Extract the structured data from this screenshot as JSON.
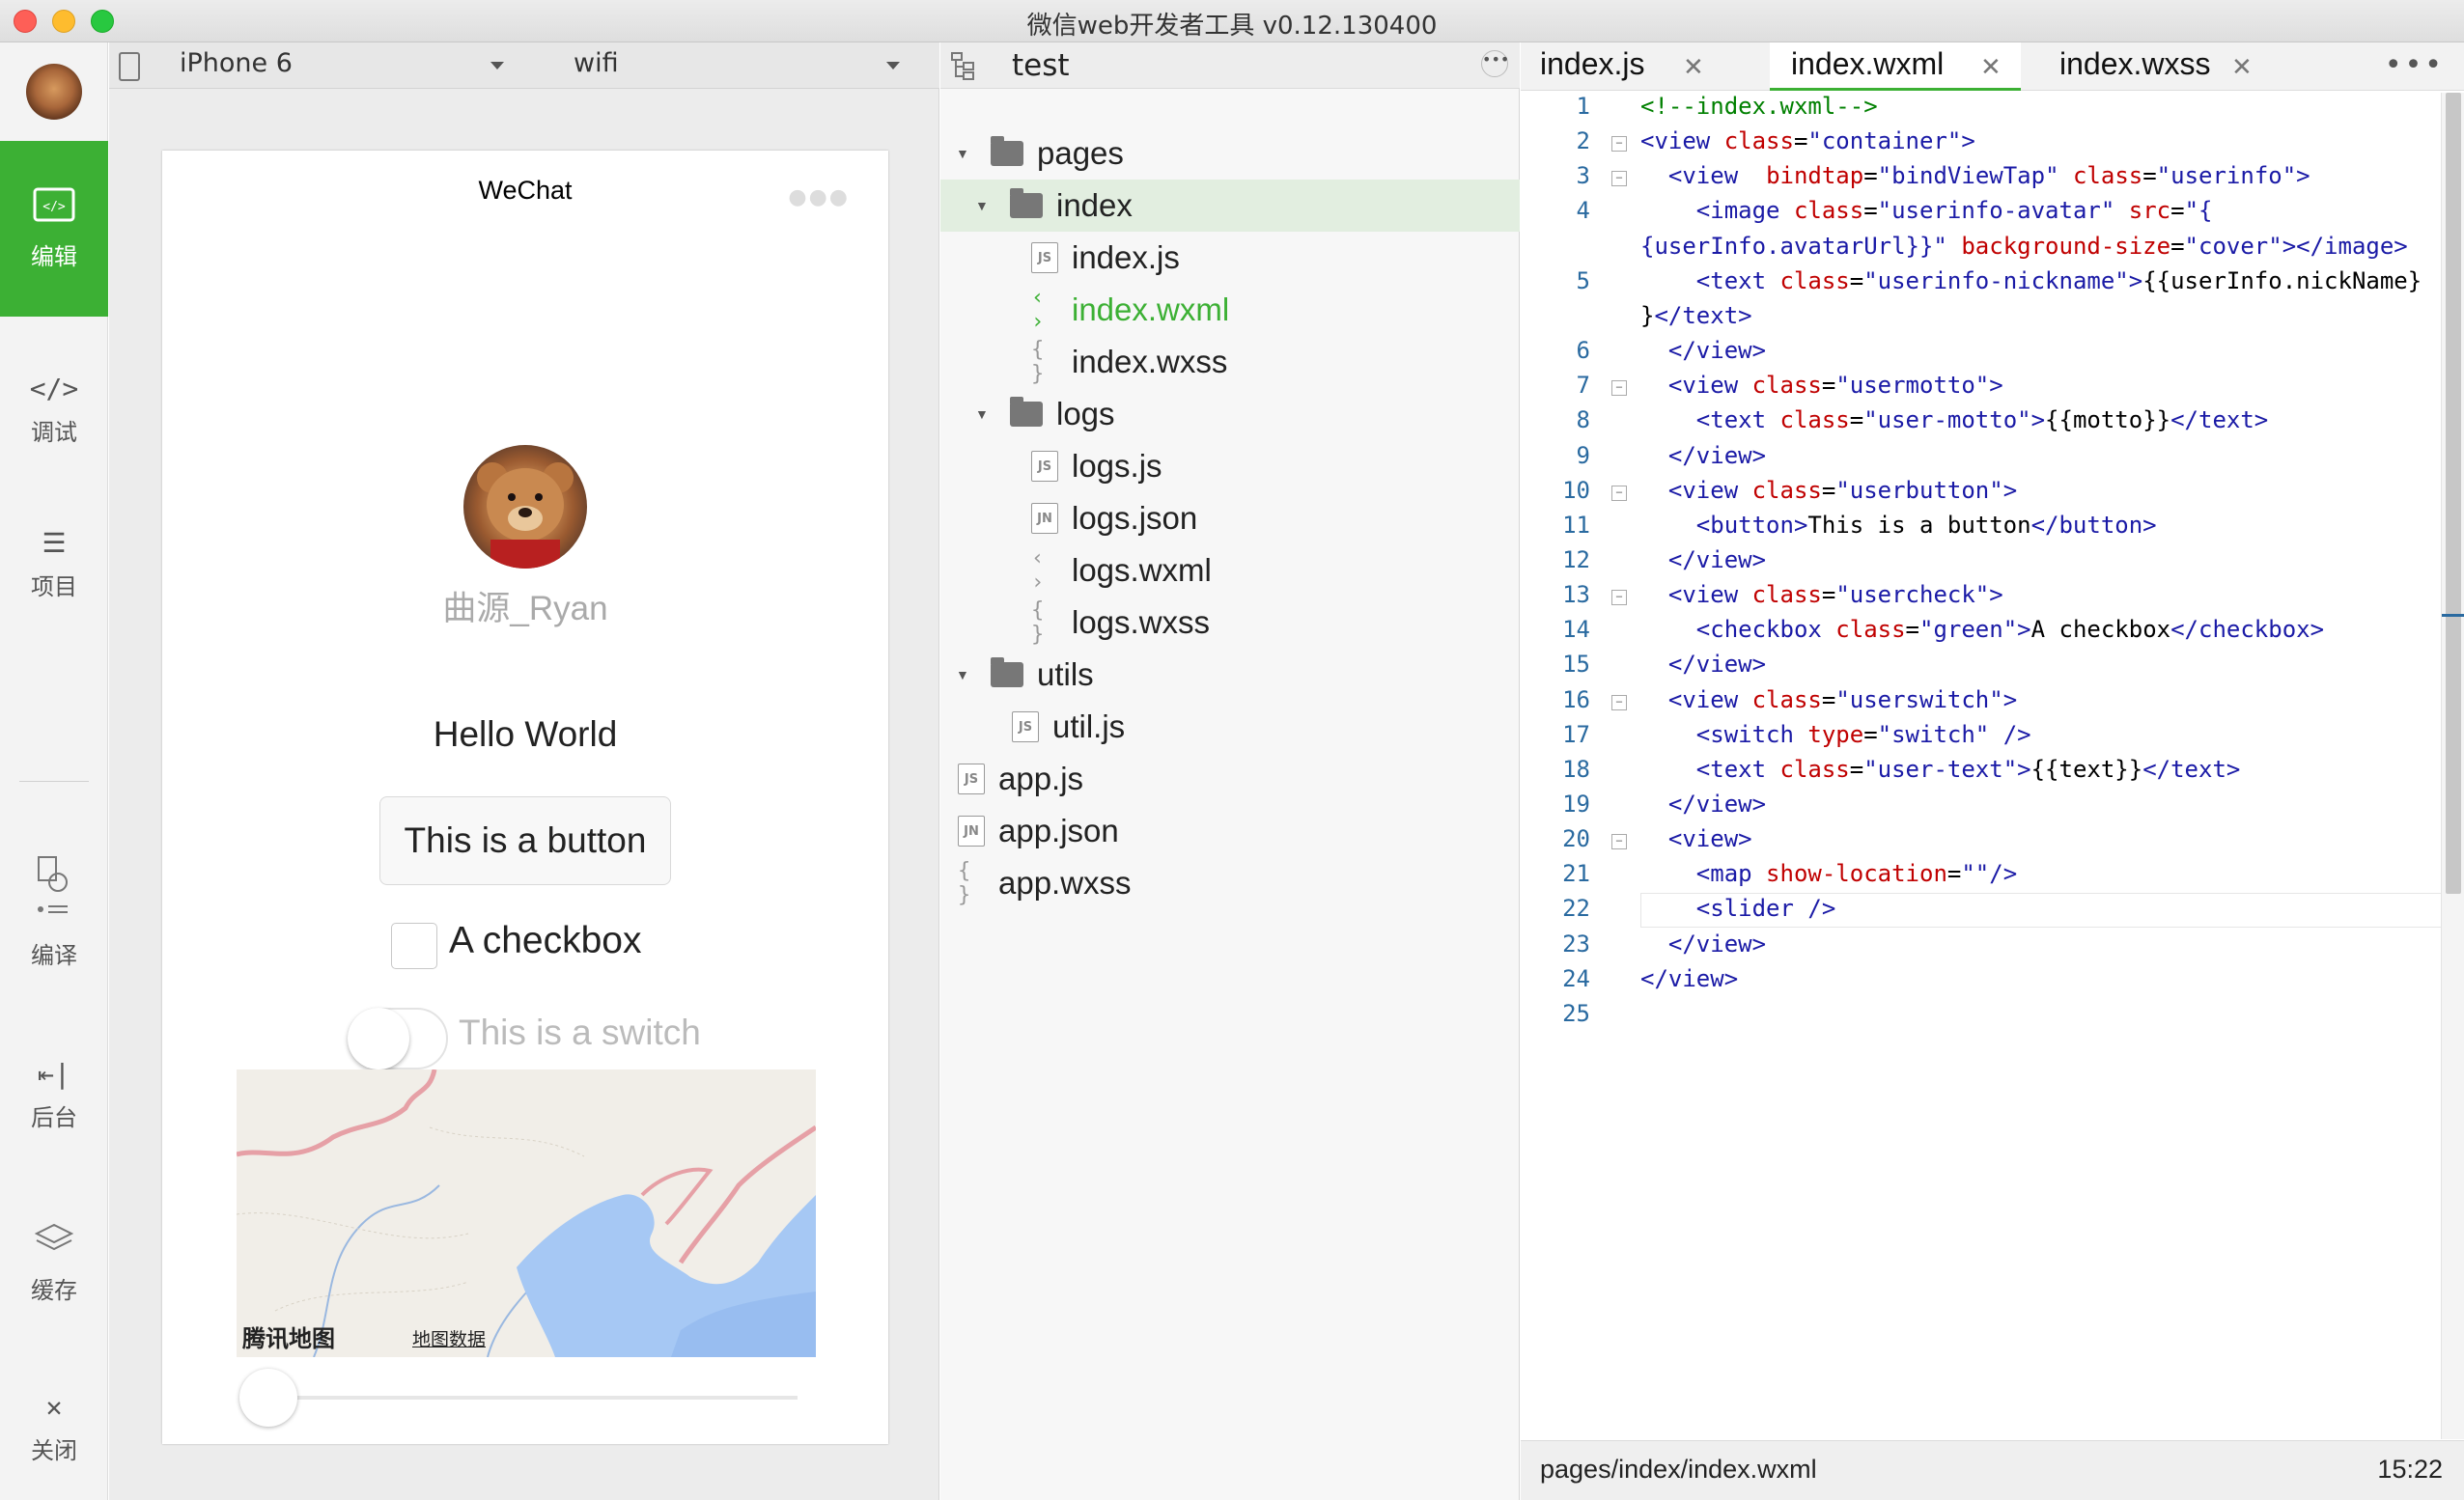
{
  "window": {
    "title": "微信web开发者工具 v0.12.130400"
  },
  "sidebar": {
    "items": [
      {
        "icon": "code-icon",
        "glyph": "<‧>",
        "label": "编辑"
      },
      {
        "icon": "debug-icon",
        "glyph": "</>",
        "label": "调试"
      },
      {
        "icon": "menu-icon",
        "glyph": "☰",
        "label": "项目"
      },
      {
        "icon": "compile-icon",
        "glyph": "⟲",
        "label": "编译"
      },
      {
        "icon": "backend-icon",
        "glyph": "⇤|",
        "label": "后台"
      },
      {
        "icon": "layers-icon",
        "glyph": "≋",
        "label": "缓存"
      },
      {
        "icon": "close-icon",
        "glyph": "✕",
        "label": "关闭"
      }
    ]
  },
  "simulator": {
    "device": "iPhone 6",
    "network": "wifi",
    "page_title": "WeChat",
    "nickname": "曲源_Ryan",
    "motto": "Hello World",
    "button_label": "This is a button",
    "checkbox_label": "A checkbox",
    "switch_label": "This is a switch",
    "map_logo": "腾讯地图",
    "map_data": "地图数据",
    "slider_value": 0
  },
  "tree": {
    "project": "test",
    "rows": [
      {
        "type": "folder",
        "name": "pages",
        "depth": 0,
        "open": true
      },
      {
        "type": "folder",
        "name": "index",
        "depth": 1,
        "open": true,
        "selected": true
      },
      {
        "type": "js",
        "name": "index.js",
        "depth": 2
      },
      {
        "type": "wxml",
        "name": "index.wxml",
        "depth": 2,
        "active": true
      },
      {
        "type": "wxss",
        "name": "index.wxss",
        "depth": 2
      },
      {
        "type": "folder",
        "name": "logs",
        "depth": 1,
        "open": true
      },
      {
        "type": "js",
        "name": "logs.js",
        "depth": 2
      },
      {
        "type": "json",
        "name": "logs.json",
        "depth": 2
      },
      {
        "type": "wxml",
        "name": "logs.wxml",
        "depth": 2
      },
      {
        "type": "wxss",
        "name": "logs.wxss",
        "depth": 2
      },
      {
        "type": "folder",
        "name": "utils",
        "depth": 0,
        "open": true
      },
      {
        "type": "js",
        "name": "util.js",
        "depth": 1
      },
      {
        "type": "js",
        "name": "app.js",
        "depth": -1
      },
      {
        "type": "json",
        "name": "app.json",
        "depth": -1
      },
      {
        "type": "wxss",
        "name": "app.wxss",
        "depth": -1
      }
    ]
  },
  "editor": {
    "tabs": [
      {
        "label": "index.js",
        "active": false
      },
      {
        "label": "index.wxml",
        "active": true
      },
      {
        "label": "index.wxss",
        "active": false
      }
    ],
    "lines": [
      {
        "n": "1",
        "fold": false,
        "html": "<span class=\"cm\">&lt;!--index.wxml--&gt;</span>"
      },
      {
        "n": "2",
        "fold": true,
        "html": "<span class=\"tg\">&lt;view</span> <span class=\"at\">class</span>=<span class=\"st\">\"container\"</span><span class=\"tg\">&gt;</span>"
      },
      {
        "n": "3",
        "fold": true,
        "html": "  <span class=\"tg\">&lt;view</span>  <span class=\"at\">bindtap</span>=<span class=\"st\">\"bindViewTap\"</span> <span class=\"at\">class</span>=<span class=\"st\">\"userinfo\"</span><span class=\"tg\">&gt;</span>"
      },
      {
        "n": "4",
        "fold": false,
        "html": "    <span class=\"tg\">&lt;image</span> <span class=\"at\">class</span>=<span class=\"st\">\"userinfo-avatar\"</span> <span class=\"at\">src</span>=<span class=\"st\">\"{</span>"
      },
      {
        "n": "",
        "fold": false,
        "html": "<span class=\"st\">{userInfo.avatarUrl}}\"</span> <span class=\"at\">background-size</span>=<span class=\"st\">\"cover\"</span><span class=\"tg\">&gt;&lt;/image&gt;</span>"
      },
      {
        "n": "5",
        "fold": false,
        "html": "    <span class=\"tg\">&lt;text</span> <span class=\"at\">class</span>=<span class=\"st\">\"userinfo-nickname\"</span><span class=\"tg\">&gt;</span>{{userInfo.nickName}"
      },
      {
        "n": "",
        "fold": false,
        "html": "}<span class=\"tg\">&lt;/text&gt;</span>"
      },
      {
        "n": "6",
        "fold": false,
        "html": "  <span class=\"tg\">&lt;/view&gt;</span>"
      },
      {
        "n": "7",
        "fold": true,
        "html": "  <span class=\"tg\">&lt;view</span> <span class=\"at\">class</span>=<span class=\"st\">\"usermotto\"</span><span class=\"tg\">&gt;</span>"
      },
      {
        "n": "8",
        "fold": false,
        "html": "    <span class=\"tg\">&lt;text</span> <span class=\"at\">class</span>=<span class=\"st\">\"user-motto\"</span><span class=\"tg\">&gt;</span>{{motto}}<span class=\"tg\">&lt;/text&gt;</span>"
      },
      {
        "n": "9",
        "fold": false,
        "html": "  <span class=\"tg\">&lt;/view&gt;</span>"
      },
      {
        "n": "10",
        "fold": true,
        "html": "  <span class=\"tg\">&lt;view</span> <span class=\"at\">class</span>=<span class=\"st\">\"userbutton\"</span><span class=\"tg\">&gt;</span>"
      },
      {
        "n": "11",
        "fold": false,
        "html": "    <span class=\"tg\">&lt;button&gt;</span>This is a button<span class=\"tg\">&lt;/button&gt;</span>"
      },
      {
        "n": "12",
        "fold": false,
        "html": "  <span class=\"tg\">&lt;/view&gt;</span>"
      },
      {
        "n": "13",
        "fold": true,
        "html": "  <span class=\"tg\">&lt;view</span> <span class=\"at\">class</span>=<span class=\"st\">\"usercheck\"</span><span class=\"tg\">&gt;</span>"
      },
      {
        "n": "14",
        "fold": false,
        "html": "    <span class=\"tg\">&lt;checkbox</span> <span class=\"at\">class</span>=<span class=\"st\">\"green\"</span><span class=\"tg\">&gt;</span>A checkbox<span class=\"tg\">&lt;/checkbox&gt;</span>"
      },
      {
        "n": "15",
        "fold": false,
        "html": "  <span class=\"tg\">&lt;/view&gt;</span>"
      },
      {
        "n": "16",
        "fold": true,
        "html": "  <span class=\"tg\">&lt;view</span> <span class=\"at\">class</span>=<span class=\"st\">\"userswitch\"</span><span class=\"tg\">&gt;</span>"
      },
      {
        "n": "17",
        "fold": false,
        "html": "    <span class=\"tg\">&lt;switch</span> <span class=\"at\">type</span>=<span class=\"st\">\"switch\"</span> <span class=\"tg\">/&gt;</span>"
      },
      {
        "n": "18",
        "fold": false,
        "html": "    <span class=\"tg\">&lt;text</span> <span class=\"at\">class</span>=<span class=\"st\">\"user-text\"</span><span class=\"tg\">&gt;</span>{{text}}<span class=\"tg\">&lt;/text&gt;</span>"
      },
      {
        "n": "19",
        "fold": false,
        "html": "  <span class=\"tg\">&lt;/view&gt;</span>"
      },
      {
        "n": "20",
        "fold": true,
        "html": "  <span class=\"tg\">&lt;view&gt;</span>"
      },
      {
        "n": "21",
        "fold": false,
        "html": "    <span class=\"tg\">&lt;map</span> <span class=\"at\">show-location</span>=<span class=\"st\">\"\"</span><span class=\"tg\">/&gt;</span>"
      },
      {
        "n": "22",
        "fold": false,
        "html": "    <span class=\"tg\">&lt;slider</span> <span class=\"tg\">/&gt;</span>",
        "current": true
      },
      {
        "n": "23",
        "fold": false,
        "html": "  <span class=\"tg\">&lt;/view&gt;</span>"
      },
      {
        "n": "24",
        "fold": false,
        "html": "<span class=\"tg\">&lt;/view&gt;</span>"
      },
      {
        "n": "25",
        "fold": false,
        "html": ""
      }
    ],
    "status_path": "pages/index/index.wxml",
    "status_pos": "15:22"
  },
  "colors": {
    "accent": "#3cb034",
    "tag": "#1a1aa6",
    "attr": "#c00000",
    "comment": "#008000"
  }
}
